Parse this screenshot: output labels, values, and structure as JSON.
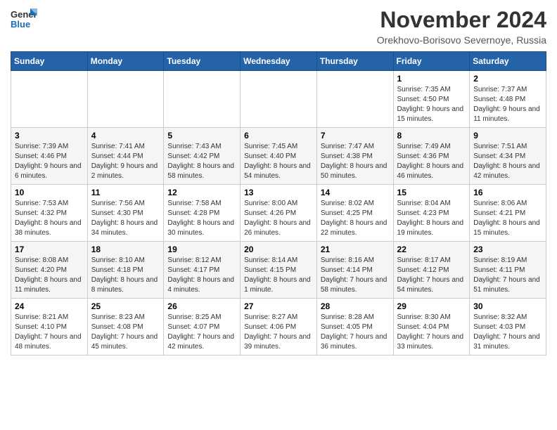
{
  "logo": {
    "line1": "General",
    "line2": "Blue"
  },
  "header": {
    "month": "November 2024",
    "location": "Orekhovo-Borisovo Severnoye, Russia"
  },
  "weekdays": [
    "Sunday",
    "Monday",
    "Tuesday",
    "Wednesday",
    "Thursday",
    "Friday",
    "Saturday"
  ],
  "weeks": [
    [
      {
        "day": "",
        "info": ""
      },
      {
        "day": "",
        "info": ""
      },
      {
        "day": "",
        "info": ""
      },
      {
        "day": "",
        "info": ""
      },
      {
        "day": "",
        "info": ""
      },
      {
        "day": "1",
        "info": "Sunrise: 7:35 AM\nSunset: 4:50 PM\nDaylight: 9 hours and 15 minutes."
      },
      {
        "day": "2",
        "info": "Sunrise: 7:37 AM\nSunset: 4:48 PM\nDaylight: 9 hours and 11 minutes."
      }
    ],
    [
      {
        "day": "3",
        "info": "Sunrise: 7:39 AM\nSunset: 4:46 PM\nDaylight: 9 hours and 6 minutes."
      },
      {
        "day": "4",
        "info": "Sunrise: 7:41 AM\nSunset: 4:44 PM\nDaylight: 9 hours and 2 minutes."
      },
      {
        "day": "5",
        "info": "Sunrise: 7:43 AM\nSunset: 4:42 PM\nDaylight: 8 hours and 58 minutes."
      },
      {
        "day": "6",
        "info": "Sunrise: 7:45 AM\nSunset: 4:40 PM\nDaylight: 8 hours and 54 minutes."
      },
      {
        "day": "7",
        "info": "Sunrise: 7:47 AM\nSunset: 4:38 PM\nDaylight: 8 hours and 50 minutes."
      },
      {
        "day": "8",
        "info": "Sunrise: 7:49 AM\nSunset: 4:36 PM\nDaylight: 8 hours and 46 minutes."
      },
      {
        "day": "9",
        "info": "Sunrise: 7:51 AM\nSunset: 4:34 PM\nDaylight: 8 hours and 42 minutes."
      }
    ],
    [
      {
        "day": "10",
        "info": "Sunrise: 7:53 AM\nSunset: 4:32 PM\nDaylight: 8 hours and 38 minutes."
      },
      {
        "day": "11",
        "info": "Sunrise: 7:56 AM\nSunset: 4:30 PM\nDaylight: 8 hours and 34 minutes."
      },
      {
        "day": "12",
        "info": "Sunrise: 7:58 AM\nSunset: 4:28 PM\nDaylight: 8 hours and 30 minutes."
      },
      {
        "day": "13",
        "info": "Sunrise: 8:00 AM\nSunset: 4:26 PM\nDaylight: 8 hours and 26 minutes."
      },
      {
        "day": "14",
        "info": "Sunrise: 8:02 AM\nSunset: 4:25 PM\nDaylight: 8 hours and 22 minutes."
      },
      {
        "day": "15",
        "info": "Sunrise: 8:04 AM\nSunset: 4:23 PM\nDaylight: 8 hours and 19 minutes."
      },
      {
        "day": "16",
        "info": "Sunrise: 8:06 AM\nSunset: 4:21 PM\nDaylight: 8 hours and 15 minutes."
      }
    ],
    [
      {
        "day": "17",
        "info": "Sunrise: 8:08 AM\nSunset: 4:20 PM\nDaylight: 8 hours and 11 minutes."
      },
      {
        "day": "18",
        "info": "Sunrise: 8:10 AM\nSunset: 4:18 PM\nDaylight: 8 hours and 8 minutes."
      },
      {
        "day": "19",
        "info": "Sunrise: 8:12 AM\nSunset: 4:17 PM\nDaylight: 8 hours and 4 minutes."
      },
      {
        "day": "20",
        "info": "Sunrise: 8:14 AM\nSunset: 4:15 PM\nDaylight: 8 hours and 1 minute."
      },
      {
        "day": "21",
        "info": "Sunrise: 8:16 AM\nSunset: 4:14 PM\nDaylight: 7 hours and 58 minutes."
      },
      {
        "day": "22",
        "info": "Sunrise: 8:17 AM\nSunset: 4:12 PM\nDaylight: 7 hours and 54 minutes."
      },
      {
        "day": "23",
        "info": "Sunrise: 8:19 AM\nSunset: 4:11 PM\nDaylight: 7 hours and 51 minutes."
      }
    ],
    [
      {
        "day": "24",
        "info": "Sunrise: 8:21 AM\nSunset: 4:10 PM\nDaylight: 7 hours and 48 minutes."
      },
      {
        "day": "25",
        "info": "Sunrise: 8:23 AM\nSunset: 4:08 PM\nDaylight: 7 hours and 45 minutes."
      },
      {
        "day": "26",
        "info": "Sunrise: 8:25 AM\nSunset: 4:07 PM\nDaylight: 7 hours and 42 minutes."
      },
      {
        "day": "27",
        "info": "Sunrise: 8:27 AM\nSunset: 4:06 PM\nDaylight: 7 hours and 39 minutes."
      },
      {
        "day": "28",
        "info": "Sunrise: 8:28 AM\nSunset: 4:05 PM\nDaylight: 7 hours and 36 minutes."
      },
      {
        "day": "29",
        "info": "Sunrise: 8:30 AM\nSunset: 4:04 PM\nDaylight: 7 hours and 33 minutes."
      },
      {
        "day": "30",
        "info": "Sunrise: 8:32 AM\nSunset: 4:03 PM\nDaylight: 7 hours and 31 minutes."
      }
    ]
  ]
}
